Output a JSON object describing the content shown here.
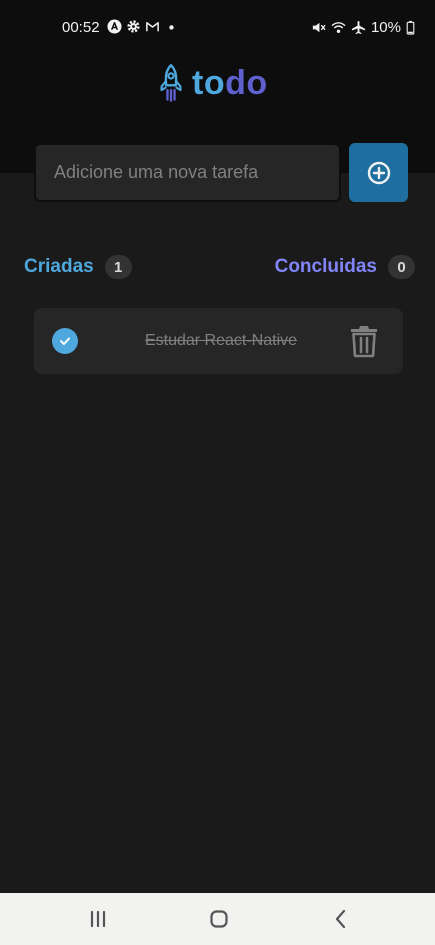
{
  "statusbar": {
    "time": "00:52",
    "battery": "10%",
    "left_icons": [
      "app-notification-icon",
      "gear-icon",
      "gmail-icon",
      "dot-icon"
    ],
    "right_icons": [
      "mute-icon",
      "wifi-icon",
      "airplane-icon",
      "battery-icon"
    ]
  },
  "app": {
    "logo_part1": "to",
    "logo_part2": "do",
    "logo_icon": "rocket-icon"
  },
  "new_task": {
    "placeholder": "Adicione uma nova tarefa",
    "add_icon": "plus-circle-icon"
  },
  "counters": {
    "created_label": "Criadas",
    "created_count": "1",
    "done_label": "Concluidas",
    "done_count": "0"
  },
  "tasks": [
    {
      "text": "Estudar React-Native",
      "completed": true
    }
  ],
  "colors": {
    "blue": "#4ea8de",
    "blue_dark": "#1e6f9f",
    "purple": "#5e60ce",
    "purple_light": "#8284fa",
    "background": "#1a1a1a",
    "header": "#0d0d0d",
    "card": "#262626"
  },
  "navbar": {
    "icons": [
      "recents-icon",
      "home-icon",
      "back-icon"
    ]
  }
}
